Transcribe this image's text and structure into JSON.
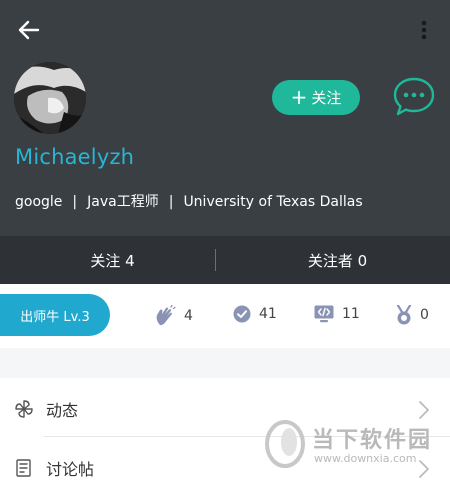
{
  "colors": {
    "header_bg": "#3a3f44",
    "stats_bg": "#2e3237",
    "accent_green": "#1fb89b",
    "accent_blue": "#27b6d3",
    "level_pill": "#20a8cf",
    "badge_icon": "#8b93b5"
  },
  "toolbar": {
    "back_icon": "arrow-left-icon",
    "more_icon": "more-vertical-icon"
  },
  "profile": {
    "username": "Michaelyzh",
    "company": "google",
    "title": "Java工程师",
    "school": "University of Texas Dallas",
    "separator": "|",
    "follow_label": "关注",
    "chat_icon": "chat-bubble-icon"
  },
  "stats": {
    "following": "关注 4",
    "followers": "关注者 0"
  },
  "badges": {
    "level": "出师牛 Lv.3",
    "items": [
      {
        "icon": "clap-icon",
        "count": "4"
      },
      {
        "icon": "check-circle-icon",
        "count": "41"
      },
      {
        "icon": "code-monitor-icon",
        "count": "11"
      },
      {
        "icon": "medal-icon",
        "count": "0"
      }
    ]
  },
  "menu": {
    "items": [
      {
        "icon": "pinwheel-icon",
        "label": "动态"
      },
      {
        "icon": "document-list-icon",
        "label": "讨论帖"
      }
    ]
  },
  "watermark": {
    "text": "当下软件园",
    "url": "www.downxia.com"
  }
}
